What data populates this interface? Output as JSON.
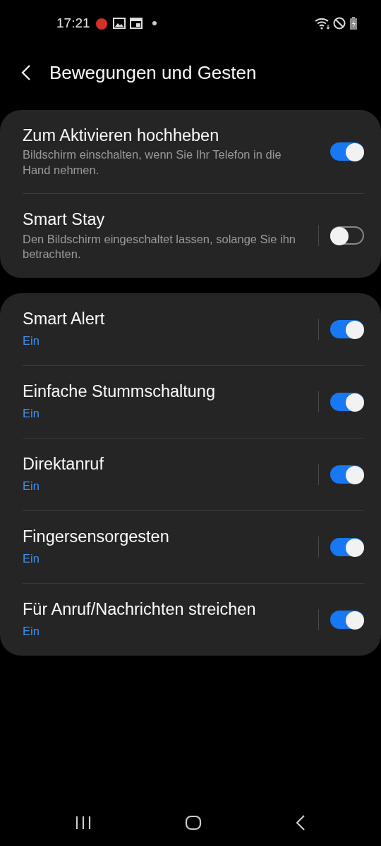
{
  "status_bar": {
    "time": "17:21"
  },
  "header": {
    "title": "Bewegungen und Gesten"
  },
  "groups": [
    {
      "items": [
        {
          "title": "Zum Aktivieren hochheben",
          "description": "Bildschirm einschalten, wenn Sie Ihr Telefon in die Hand nehmen.",
          "separator": false,
          "on": true
        },
        {
          "title": "Smart Stay",
          "description": "Den Bildschirm eingeschaltet lassen, solange Sie ihn betrachten.",
          "separator": true,
          "on": false
        }
      ]
    },
    {
      "items": [
        {
          "title": "Smart Alert",
          "status": "Ein",
          "separator": true,
          "on": true
        },
        {
          "title": "Einfache Stummschaltung",
          "status": "Ein",
          "separator": true,
          "on": true
        },
        {
          "title": "Direktanruf",
          "status": "Ein",
          "separator": true,
          "on": true
        },
        {
          "title": "Fingersensorgesten",
          "status": "Ein",
          "separator": true,
          "on": true
        },
        {
          "title": "Für Anruf/Nachrichten streichen",
          "status": "Ein",
          "separator": true,
          "on": true
        }
      ]
    }
  ]
}
